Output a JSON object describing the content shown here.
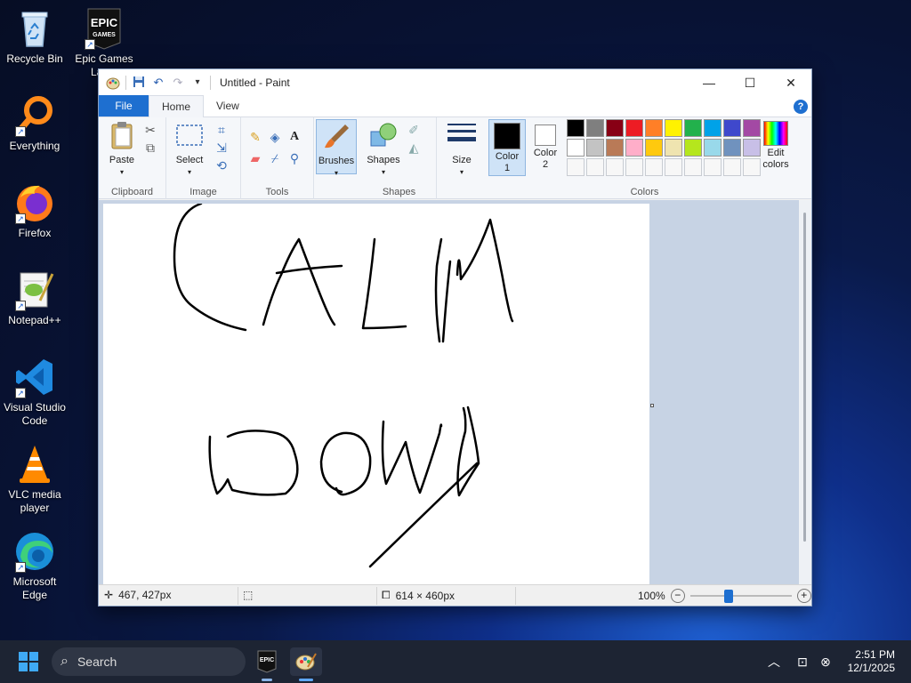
{
  "desktop": {
    "icons": [
      {
        "label": "Recycle Bin"
      },
      {
        "label": "Epic Games Lau..."
      },
      {
        "label": "Everything"
      },
      {
        "label": "Firefox"
      },
      {
        "label": "Notepad++"
      },
      {
        "label": "Visual Studio Code"
      },
      {
        "label": "VLC media player"
      },
      {
        "label": "Microsoft Edge"
      }
    ]
  },
  "window": {
    "title": "Untitled - Paint",
    "tabs": {
      "file": "File",
      "home": "Home",
      "view": "View"
    },
    "ribbon": {
      "clipboard": {
        "paste": "Paste",
        "label": "Clipboard"
      },
      "image": {
        "select": "Select",
        "label": "Image"
      },
      "tools": {
        "label": "Tools"
      },
      "brushes": {
        "label": "Brushes"
      },
      "shapes": {
        "shapes": "Shapes",
        "label": "Shapes"
      },
      "size": {
        "label": "Size"
      },
      "colors": {
        "color1": "Color",
        "color1_num": "1",
        "color2": "Color",
        "color2_num": "2",
        "edit": "Edit",
        "edit2": "colors",
        "label": "Colors",
        "color1_value": "#000000",
        "color2_value": "#ffffff",
        "palette_row1": [
          "#000000",
          "#7f7f7f",
          "#880015",
          "#ed1c24",
          "#ff7f27",
          "#fff200",
          "#22b14c",
          "#00a2e8",
          "#3f48cc",
          "#a349a4"
        ],
        "palette_row2": [
          "#ffffff",
          "#c3c3c3",
          "#b97a57",
          "#ffaec9",
          "#ffc90e",
          "#efe4b0",
          "#b5e61d",
          "#99d9ea",
          "#7092be",
          "#c8bfe7"
        ]
      }
    },
    "canvas_text_drawn": "CALM DOWN",
    "status": {
      "cursor_pos": "467, 427px",
      "canvas_size": "614 × 460px",
      "zoom": "100%"
    }
  },
  "taskbar": {
    "search_placeholder": "Search",
    "time": "2:51 PM",
    "date": "12/1/2025"
  }
}
